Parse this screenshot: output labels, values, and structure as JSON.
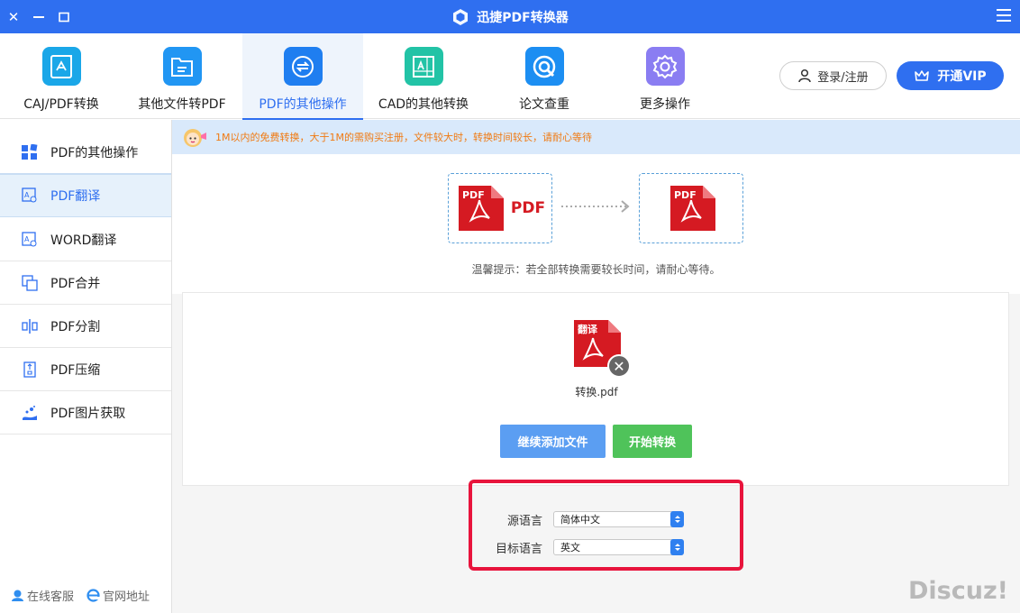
{
  "window": {
    "title": "迅捷PDF转换器",
    "controls": [
      "close-icon",
      "minimize-icon",
      "maximize-icon"
    ]
  },
  "toolbar": {
    "tools": [
      {
        "label": "CAJ/PDF转换",
        "icon": "caj-convert-icon",
        "color": "#1aa7e8"
      },
      {
        "label": "其他文件转PDF",
        "icon": "file-to-pdf-icon",
        "color": "#2196f3"
      },
      {
        "label": "PDF的其他操作",
        "icon": "pdf-ops-icon",
        "color": "#1f7ef0"
      },
      {
        "label": "CAD的其他转换",
        "icon": "cad-convert-icon",
        "color": "#22c3a6"
      },
      {
        "label": "论文查重",
        "icon": "paper-check-icon",
        "color": "#1c8ef2"
      },
      {
        "label": "更多操作",
        "icon": "more-ops-icon",
        "color": "#8a7df2"
      }
    ],
    "active_index": 2,
    "login_label": "登录/注册",
    "vip_label": "开通VIP"
  },
  "sidebar": {
    "items": [
      {
        "label": "PDF的其他操作",
        "icon": "grid-icon"
      },
      {
        "label": "PDF翻译",
        "icon": "translate-icon"
      },
      {
        "label": "WORD翻译",
        "icon": "word-translate-icon"
      },
      {
        "label": "PDF合并",
        "icon": "merge-icon"
      },
      {
        "label": "PDF分割",
        "icon": "split-icon"
      },
      {
        "label": "PDF压缩",
        "icon": "compress-icon"
      },
      {
        "label": "PDF图片获取",
        "icon": "image-extract-icon"
      }
    ],
    "active_index": 1,
    "footer": {
      "support_label": "在线客服",
      "website_label": "官网地址"
    }
  },
  "main": {
    "notice": "1M以内的免费转换，大于1M的需购买注册，文件较大时，转换时间较长，请耐心等待",
    "flow": {
      "source_badge": "PDF",
      "source_text": "PDF",
      "target_badge": "PDF",
      "tip": "温馨提示：若全部转换需要较长时间，请耐心等待。"
    },
    "file": {
      "badge": "翻译",
      "name": "转换.pdf"
    },
    "buttons": {
      "add": "继续添加文件",
      "start": "开始转换"
    },
    "language": {
      "source_label": "源语言",
      "source_value": "简体中文",
      "target_label": "目标语言",
      "target_value": "英文"
    }
  },
  "watermark": "Discuz!",
  "colors": {
    "brand_blue": "#2f6ff0",
    "pdf_red": "#d51a22",
    "notice_orange": "#f07a12",
    "start_green": "#4fc35a",
    "highlight_red": "#e8143c"
  }
}
